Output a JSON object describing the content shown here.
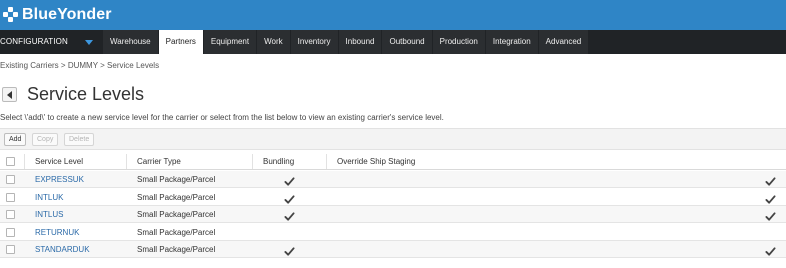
{
  "brand": {
    "name": "BlueYonder"
  },
  "nav": {
    "config_label": "CONFIGURATION",
    "tabs": [
      {
        "label": "Warehouse",
        "active": false
      },
      {
        "label": "Partners",
        "active": true
      },
      {
        "label": "Equipment",
        "active": false
      },
      {
        "label": "Work",
        "active": false
      },
      {
        "label": "Inventory",
        "active": false
      },
      {
        "label": "Inbound",
        "active": false
      },
      {
        "label": "Outbound",
        "active": false
      },
      {
        "label": "Production",
        "active": false
      },
      {
        "label": "Integration",
        "active": false
      },
      {
        "label": "Advanced",
        "active": false
      }
    ]
  },
  "breadcrumb": {
    "items": [
      "Existing Carriers",
      "DUMMY",
      "Service Levels"
    ],
    "separator": ">"
  },
  "page": {
    "title": "Service Levels",
    "instructions": "Select \\'add\\' to create a new service level for the carrier or select from the list below to view an existing carrier's service level."
  },
  "toolbar": {
    "add_label": "Add",
    "copy_label": "Copy",
    "delete_label": "Delete"
  },
  "table": {
    "columns": {
      "service_level": "Service Level",
      "carrier_type": "Carrier Type",
      "bundling": "Bundling",
      "override_ship_staging": "Override Ship Staging"
    },
    "rows": [
      {
        "service_level": "EXPRESSUK",
        "carrier_type": "Small Package/Parcel",
        "bundling": true,
        "last_col_checked": true
      },
      {
        "service_level": "INTLUK",
        "carrier_type": "Small Package/Parcel",
        "bundling": true,
        "last_col_checked": true
      },
      {
        "service_level": "INTLUS",
        "carrier_type": "Small Package/Parcel",
        "bundling": true,
        "last_col_checked": true
      },
      {
        "service_level": "RETURNUK",
        "carrier_type": "Small Package/Parcel",
        "bundling": false,
        "last_col_checked": false
      },
      {
        "service_level": "STANDARDUK",
        "carrier_type": "Small Package/Parcel",
        "bundling": true,
        "last_col_checked": true
      }
    ]
  },
  "colors": {
    "topbar": "#2f85c6",
    "navbar": "#202326",
    "link": "#2b6aa8"
  },
  "icons": {
    "logo": "blueyonder-logo-icon",
    "config_dropdown": "chevron-down-icon",
    "back": "back-arrow-icon",
    "check": "check-icon"
  }
}
